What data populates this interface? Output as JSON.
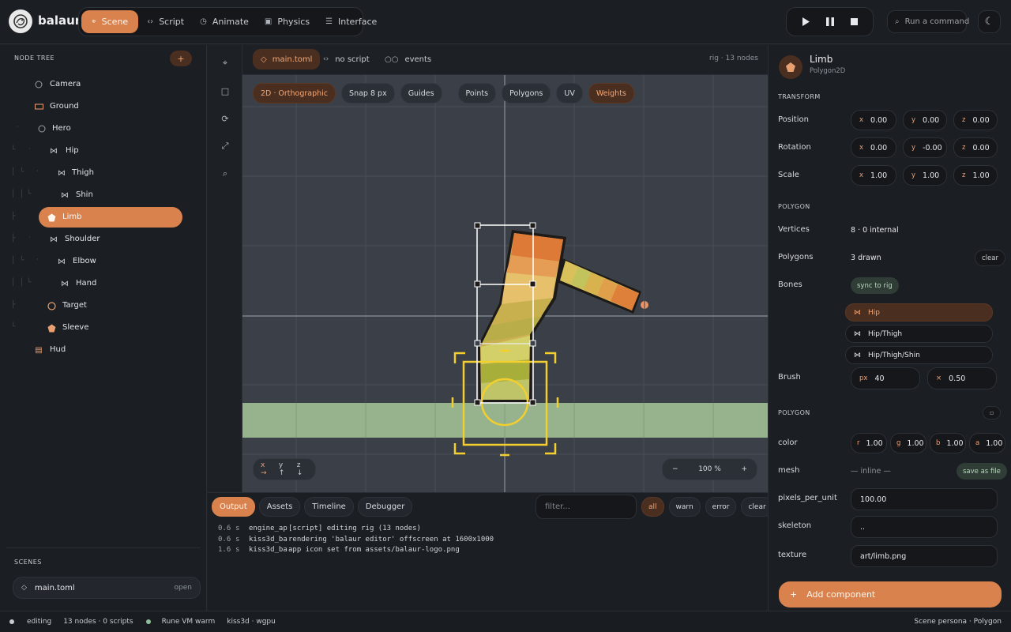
{
  "app": {
    "name": "balaur"
  },
  "mode_tabs": [
    {
      "label": "Scene",
      "icon": "crosshair-icon",
      "active": true
    },
    {
      "label": "Script",
      "icon": "code-icon",
      "active": false
    },
    {
      "label": "Animate",
      "icon": "clock-icon",
      "active": false
    },
    {
      "label": "Physics",
      "icon": "cube-icon",
      "active": false
    },
    {
      "label": "Interface",
      "icon": "layout-icon",
      "active": false
    }
  ],
  "command": {
    "placeholder": "Run a command"
  },
  "node_tree": {
    "title": "NODE TREE",
    "add_label": "+",
    "items": [
      {
        "label": "Camera",
        "icon": "camera-circle-icon"
      },
      {
        "label": "Ground",
        "icon": "rectangle-icon"
      },
      {
        "label": "Hero",
        "icon": "circle-icon"
      },
      {
        "label": "Hip",
        "icon": "bone-icon"
      },
      {
        "label": "Thigh",
        "icon": "bone-icon"
      },
      {
        "label": "Shin",
        "icon": "bone-icon"
      },
      {
        "label": "Limb",
        "icon": "polygon-icon",
        "selected": true
      },
      {
        "label": "Shoulder",
        "icon": "bone-icon"
      },
      {
        "label": "Elbow",
        "icon": "bone-icon"
      },
      {
        "label": "Hand",
        "icon": "bone-icon"
      },
      {
        "label": "Target",
        "icon": "circle-icon"
      },
      {
        "label": "Sleeve",
        "icon": "polygon-icon"
      },
      {
        "label": "Hud",
        "icon": "list-icon"
      }
    ]
  },
  "scenes": {
    "title": "SCENES",
    "file": "main.toml",
    "open_label": "open"
  },
  "viewport": {
    "file_tab": "main.toml",
    "script_tab": "no script",
    "events_tab": "events",
    "info": "rig · 13 nodes",
    "toolbar": {
      "projection": "2D · Orthographic",
      "snap": "Snap 8 px",
      "guides": "Guides",
      "points": "Points",
      "polygons": "Polygons",
      "uv": "UV",
      "weights": "Weights"
    },
    "axes": {
      "x": "x →",
      "y": "y ↑",
      "z": "z ↓"
    },
    "zoom": {
      "minus": "−",
      "value": "100 %",
      "plus": "+"
    }
  },
  "console": {
    "tabs": [
      "Output",
      "Assets",
      "Timeline",
      "Debugger"
    ],
    "filter_placeholder": "filter...",
    "levels": [
      "all",
      "warn",
      "error",
      "clear"
    ],
    "logs": [
      {
        "time": "0.6",
        "unit": "s",
        "source": "engine_ap",
        "message": "[script] editing rig (13 nodes)"
      },
      {
        "time": "0.6",
        "unit": "s",
        "source": "kiss3d_ba",
        "message": "rendering 'balaur editor' offscreen at 1600x1000"
      },
      {
        "time": "1.6",
        "unit": "s",
        "source": "kiss3d_ba",
        "message": "app icon set from assets/balaur-logo.png"
      }
    ]
  },
  "status": {
    "mode": "editing",
    "counts": "13 nodes · 0 scripts",
    "vm": "Rune VM warm",
    "renderer": "kiss3d · wgpu",
    "persona": "Scene persona · Polygon"
  },
  "inspector": {
    "name": "Limb",
    "type": "Polygon2D",
    "transform_title": "TRANSFORM",
    "position": {
      "label": "Position",
      "x": "0.00",
      "y": "0.00",
      "z": "0.00"
    },
    "rotation": {
      "label": "Rotation",
      "x": "0.00",
      "y": "-0.00",
      "z": "0.00"
    },
    "scale": {
      "label": "Scale",
      "x": "1.00",
      "y": "1.00",
      "z": "1.00"
    },
    "polygon_title": "POLYGON",
    "vertices": {
      "label": "Vertices",
      "value": "8 · 0 internal"
    },
    "polygons": {
      "label": "Polygons",
      "value": "3 drawn",
      "action": "clear"
    },
    "bones": {
      "label": "Bones",
      "action": "sync to rig",
      "items": [
        {
          "label": "Hip",
          "active": true
        },
        {
          "label": "Hip/Thigh",
          "active": false
        },
        {
          "label": "Hip/Thigh/Shin",
          "active": false
        }
      ]
    },
    "brush": {
      "label": "Brush",
      "px_unit": "px",
      "px": "40",
      "x_unit": "×",
      "x": "0.50"
    },
    "polygon2_title": "POLYGON",
    "color": {
      "label": "color",
      "r": "1.00",
      "g": "1.00",
      "b": "1.00",
      "a": "1.00"
    },
    "mesh": {
      "label": "mesh",
      "value": "— inline —",
      "action": "save as file"
    },
    "pixels_per_unit": {
      "label": "pixels_per_unit",
      "value": "100.00"
    },
    "skeleton": {
      "label": "skeleton",
      "value": ".."
    },
    "texture": {
      "label": "texture",
      "value": "art/limb.png"
    },
    "add_component": "Add component"
  }
}
